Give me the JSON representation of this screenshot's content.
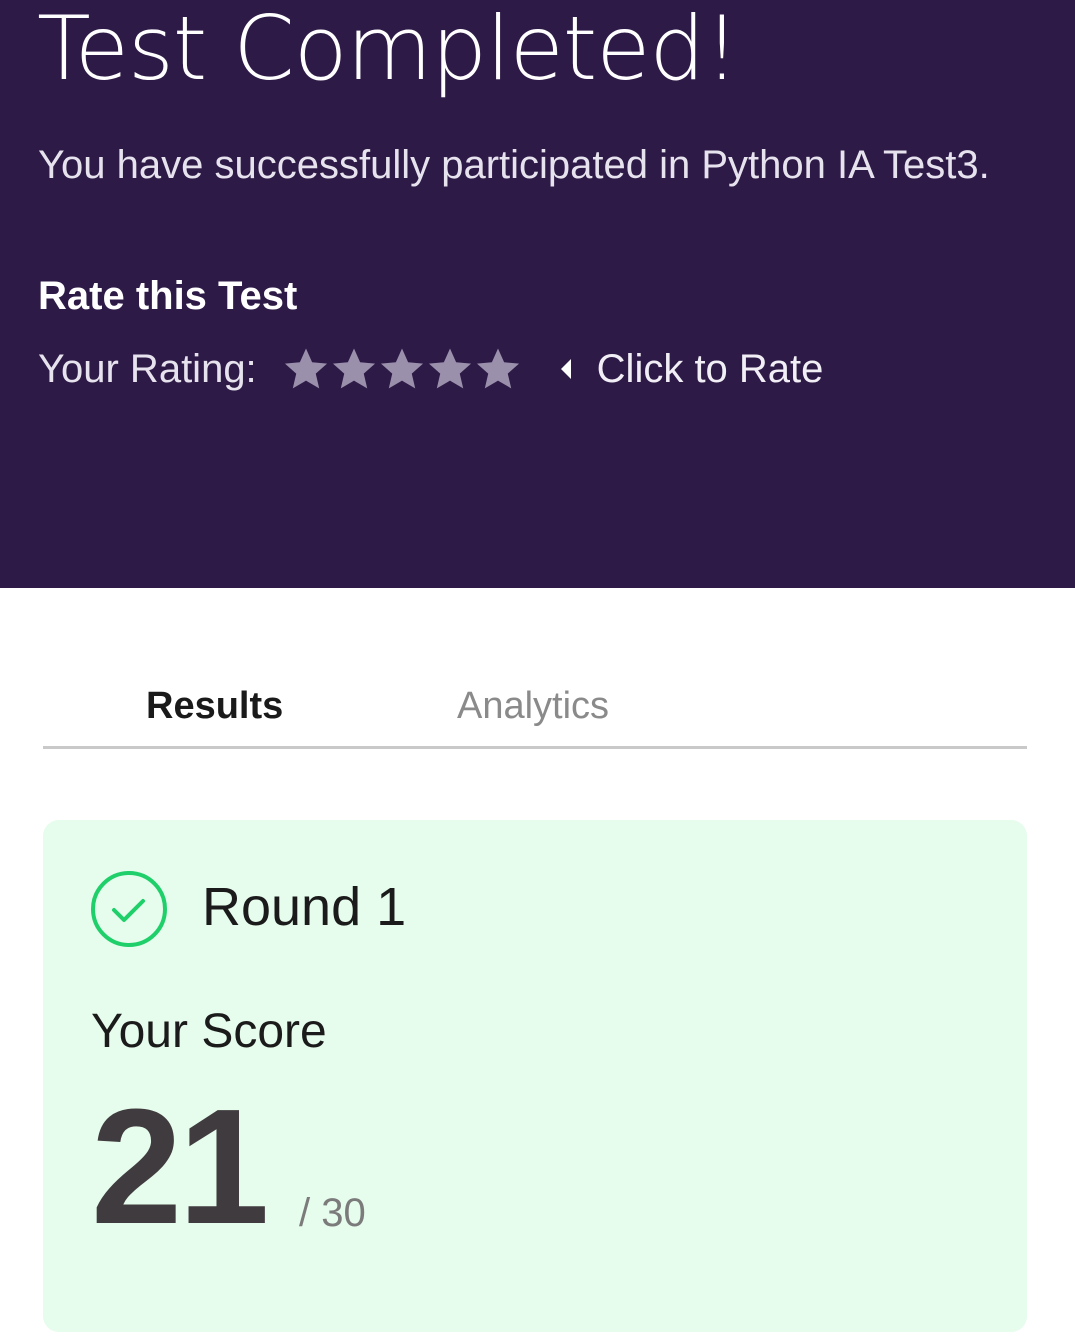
{
  "hero": {
    "title": "Test Completed!",
    "subtitle": "You have successfully participated in Python IA Test3.",
    "rate_heading": "Rate this Test",
    "rating_label": "Your Rating:",
    "rating_value": 0,
    "rating_max": 5,
    "click_to_rate": "Click to Rate",
    "background_color": "#2e1a47",
    "star_color": "#9a90ac"
  },
  "tabs": [
    {
      "label": "Results",
      "active": true
    },
    {
      "label": "Analytics",
      "active": false
    }
  ],
  "result": {
    "round_title": "Round 1",
    "status_icon": "check-circle-icon",
    "status_color": "#1fcf6a",
    "score_label": "Your Score",
    "score": "21",
    "score_total": "/ 30",
    "card_color": "#e6fcec"
  }
}
